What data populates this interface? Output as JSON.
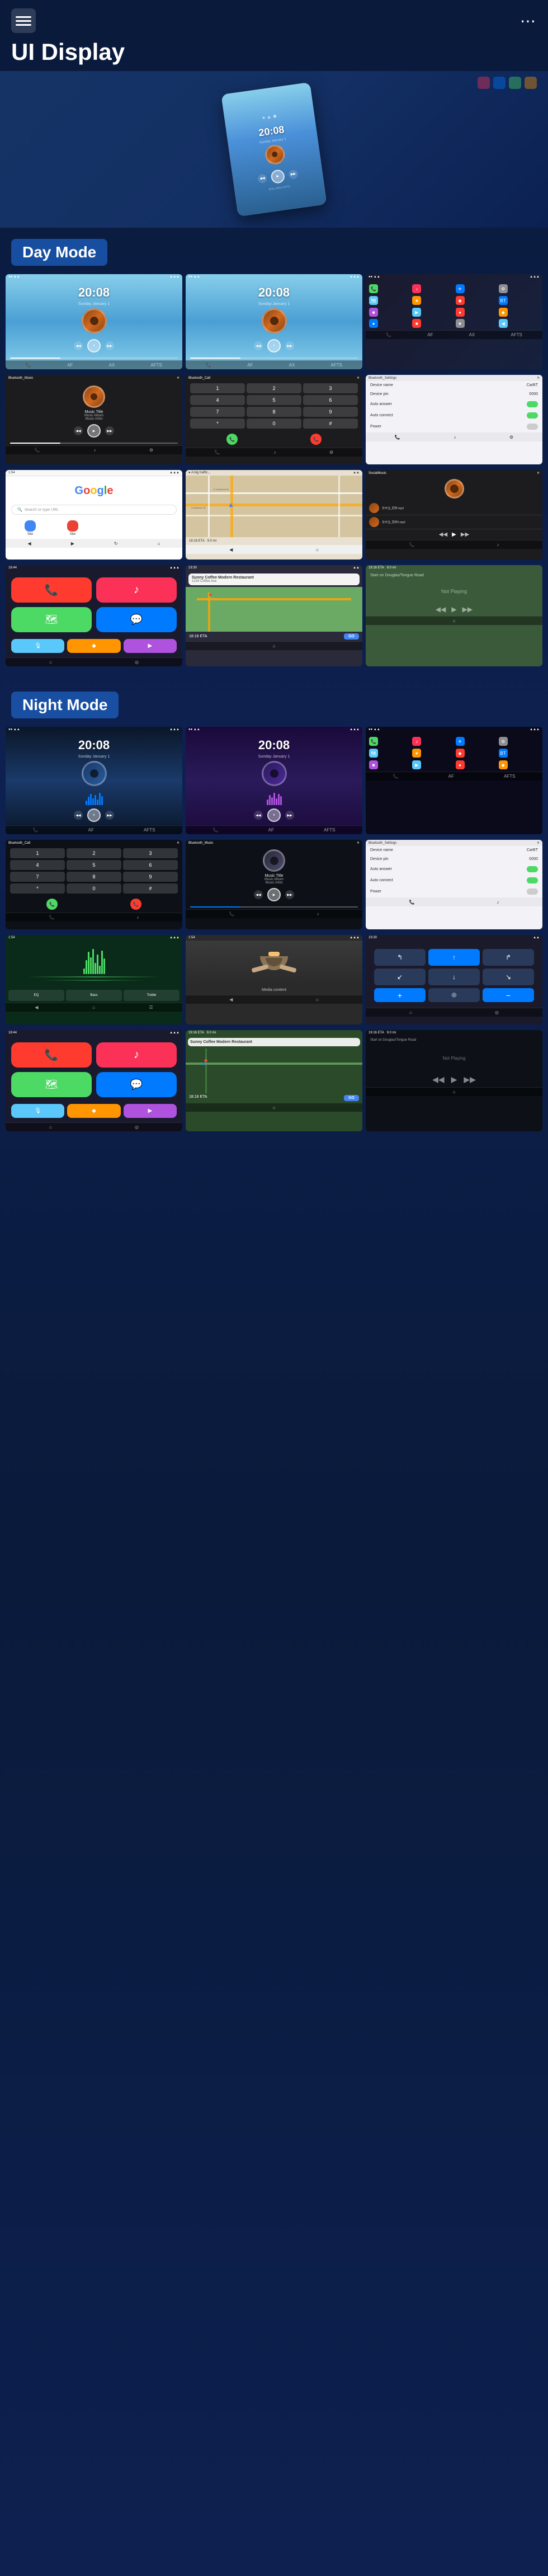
{
  "header": {
    "title": "UI Display",
    "menu_icon": "☰",
    "dots_icon": "⋯"
  },
  "day_mode": {
    "label": "Day Mode",
    "screens": [
      {
        "id": "day-home-1",
        "type": "home",
        "time": "20:08",
        "sub": "Sunday January 1"
      },
      {
        "id": "day-home-2",
        "type": "home",
        "time": "20:08",
        "sub": "Sunday January 1"
      },
      {
        "id": "day-apps",
        "type": "apps"
      },
      {
        "id": "day-bluetooth",
        "type": "bluetooth",
        "title": "Bluetooth_Music"
      },
      {
        "id": "day-call",
        "type": "call",
        "title": "Bluetooth_Call"
      },
      {
        "id": "day-settings",
        "type": "settings",
        "title": "Bluetooth_Settings"
      },
      {
        "id": "day-google",
        "type": "google"
      },
      {
        "id": "day-map",
        "type": "map"
      },
      {
        "id": "day-social",
        "type": "social",
        "title": "SocialMusic"
      }
    ]
  },
  "carplay": {
    "screens": [
      {
        "id": "carplay-home",
        "type": "carplay-home"
      },
      {
        "id": "carplay-nav",
        "type": "navigation",
        "restaurant": "Sunny Coffee Modern Restaurant",
        "eta": "18:18 ETA",
        "distance": "9.0 km"
      },
      {
        "id": "carplay-np",
        "type": "now-playing",
        "status": "Not Playing"
      }
    ]
  },
  "night_mode": {
    "label": "Night Mode",
    "screens": [
      {
        "id": "night-home-1",
        "type": "night-home",
        "time": "20:08"
      },
      {
        "id": "night-home-2",
        "type": "night-home-2",
        "time": "20:08"
      },
      {
        "id": "night-apps",
        "type": "night-apps"
      },
      {
        "id": "night-call",
        "type": "night-call",
        "title": "Bluetooth_Call"
      },
      {
        "id": "night-music",
        "type": "night-music",
        "title": "Bluetooth_Music"
      },
      {
        "id": "night-settings",
        "type": "night-settings",
        "title": "Bluetooth_Settings"
      },
      {
        "id": "night-waves",
        "type": "night-waves"
      },
      {
        "id": "night-bowl",
        "type": "night-bowl"
      },
      {
        "id": "night-nav",
        "type": "night-nav"
      }
    ]
  },
  "night_carplay": {
    "screens": [
      {
        "id": "night-carplay-home",
        "type": "night-carplay-home"
      },
      {
        "id": "night-carplay-map",
        "type": "night-carplay-map",
        "restaurant": "Sunny Coffee Modern Restaurant",
        "eta": "18:18 ETA"
      },
      {
        "id": "night-carplay-np",
        "type": "night-now-playing",
        "status": "Not Playing"
      }
    ]
  },
  "music": {
    "title": "Music Title",
    "album": "Music Album",
    "artist": "Music Artist"
  },
  "settings_items": [
    {
      "label": "Device name",
      "value": "CarBT"
    },
    {
      "label": "Device pin",
      "value": "0000"
    },
    {
      "label": "Auto answer",
      "value": "toggle-on"
    },
    {
      "label": "Auto connect",
      "value": "toggle-on"
    },
    {
      "label": "Power",
      "value": "toggle-off"
    }
  ],
  "nav": {
    "restaurant": "Sunny Coffee Modern Restaurant",
    "address": "123 Modern Ave",
    "eta_label": "18:18 ETA",
    "distance": "9.0 km",
    "start_label": "Start on Douglas/Tongue Road",
    "go_label": "GO"
  }
}
